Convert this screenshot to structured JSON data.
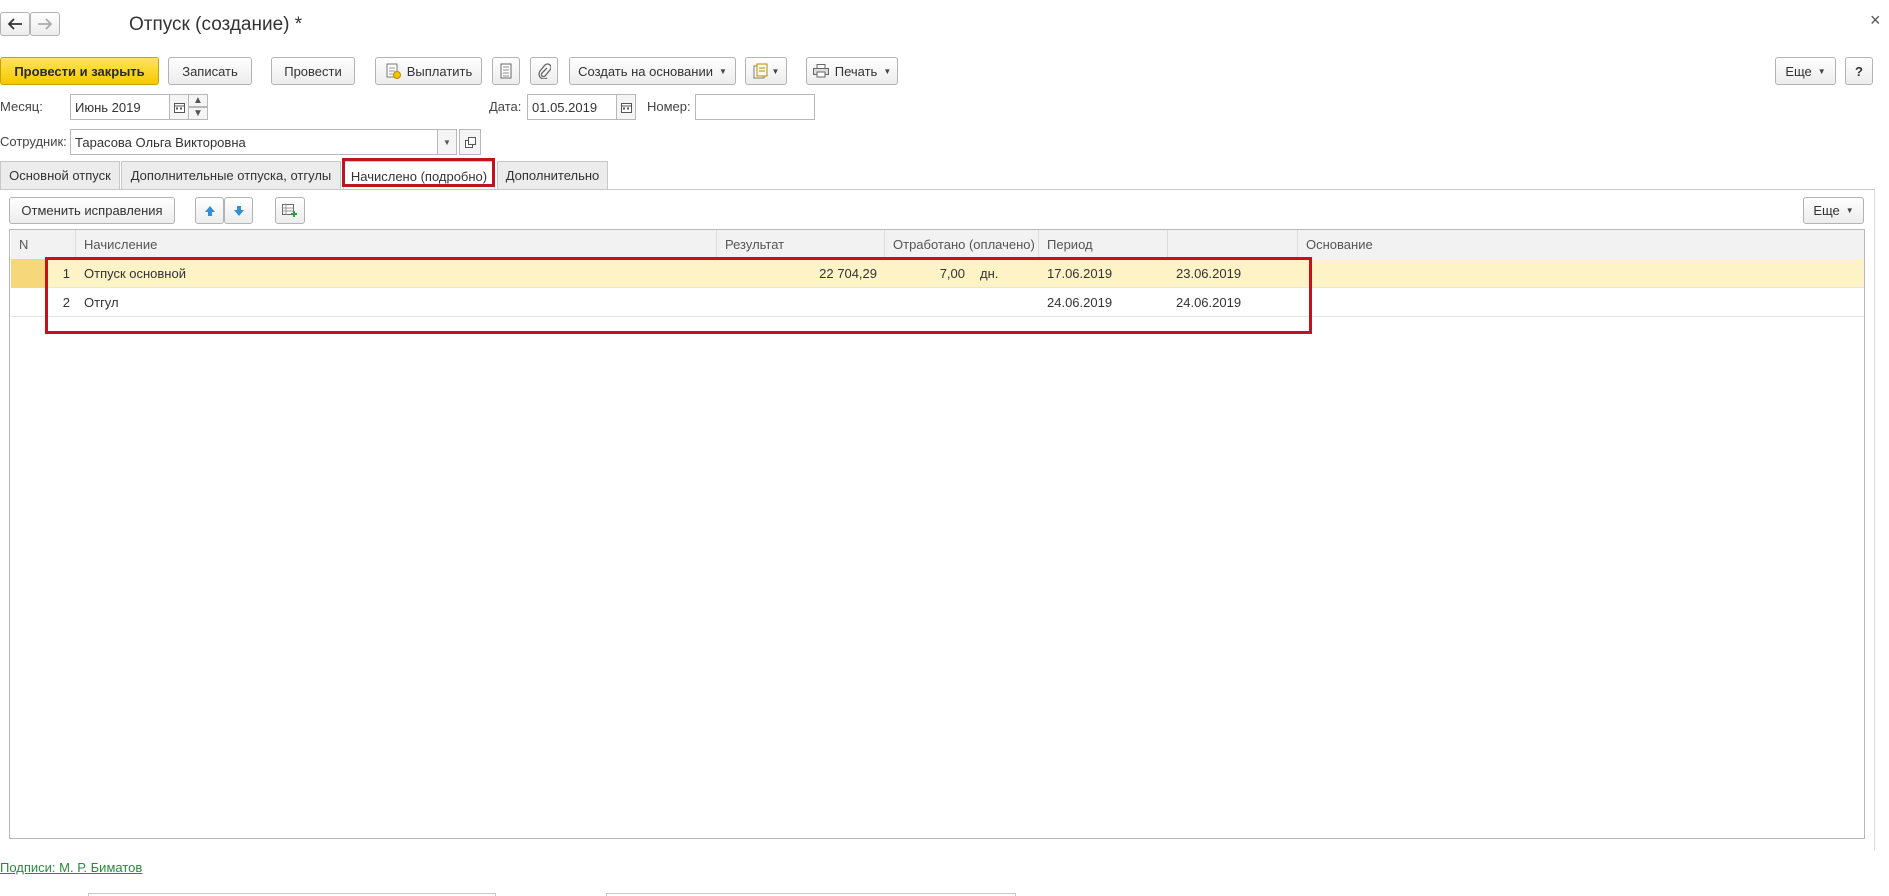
{
  "window": {
    "title": "Отпуск (создание) *",
    "close_glyph": "×"
  },
  "nav": {
    "back_icon": "arrow-left-icon",
    "forward_icon": "arrow-right-icon"
  },
  "toolbar": {
    "post_and_close": "Провести и закрыть",
    "save": "Записать",
    "post": "Провести",
    "pay": "Выплатить",
    "create_based_on": "Создать на основании",
    "print": "Печать",
    "more": "Еще",
    "help": "?"
  },
  "header": {
    "month_label": "Месяц:",
    "month_value": "Июнь 2019",
    "date_label": "Дата:",
    "date_value": "01.05.2019",
    "number_label": "Номер:",
    "number_value": "",
    "employee_label": "Сотрудник:",
    "employee_value": "Тарасова Ольга Викторовна"
  },
  "tabs": [
    {
      "label": "Основной отпуск",
      "active": false
    },
    {
      "label": "Дополнительные отпуска, отгулы",
      "active": false
    },
    {
      "label": "Начислено (подробно)",
      "active": true
    },
    {
      "label": "Дополнительно",
      "active": false
    }
  ],
  "table_toolbar": {
    "cancel_corrections": "Отменить исправления",
    "more": "Еще"
  },
  "table": {
    "columns": [
      "N",
      "Начисление",
      "Результат",
      "Отработано (оплачено)",
      "Период",
      "",
      "Основание"
    ],
    "rows": [
      {
        "n": "1",
        "accrual": "Отпуск основной",
        "result": "22 704,29",
        "worked": "7,00",
        "unit": "дн.",
        "from": "17.06.2019",
        "to": "23.06.2019",
        "basis": ""
      },
      {
        "n": "2",
        "accrual": "Отгул",
        "result": "",
        "worked": "",
        "unit": "",
        "from": "24.06.2019",
        "to": "24.06.2019",
        "basis": ""
      }
    ]
  },
  "footer": {
    "signatures_link": "Подписи: М. Р. Биматов"
  },
  "colors": {
    "accent_yellow": "#f7c800",
    "highlight_red": "#c0141c",
    "selected_row": "#fdf3c6",
    "link_green": "#2a8a3e"
  }
}
